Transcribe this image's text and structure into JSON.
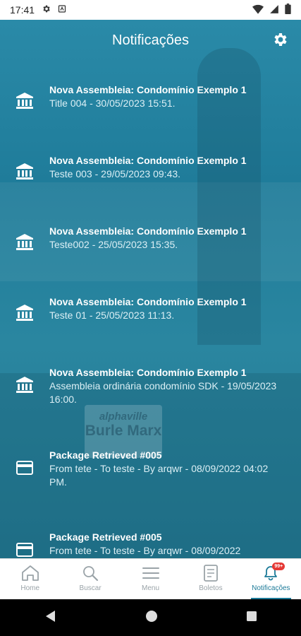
{
  "status_bar": {
    "time": "17:41"
  },
  "header": {
    "title": "Notificações"
  },
  "notifications": [
    {
      "title": "Nova Assembleia: Condomínio Exemplo 1",
      "subtitle": "Title 004 - 30/05/2023 15:51.",
      "icon": "bank-icon"
    },
    {
      "title": "Nova Assembleia: Condomínio Exemplo 1",
      "subtitle": "Teste 003 - 29/05/2023 09:43.",
      "icon": "bank-icon"
    },
    {
      "title": "Nova Assembleia: Condomínio Exemplo 1",
      "subtitle": "Teste002 - 25/05/2023 15:35.",
      "icon": "bank-icon"
    },
    {
      "title": "Nova Assembleia: Condomínio Exemplo 1",
      "subtitle": "Teste 01 - 25/05/2023 11:13.",
      "icon": "bank-icon"
    },
    {
      "title": "Nova Assembleia: Condomínio Exemplo 1",
      "subtitle": "Assembleia ordinária condomínio SDK - 19/05/2023 16:00.",
      "icon": "bank-icon"
    },
    {
      "title": "Package Retrieved #005",
      "subtitle": "From tete - To teste - By arqwr - 08/09/2022 04:02 PM.",
      "icon": "card-icon"
    },
    {
      "title": "Package Retrieved #005",
      "subtitle": "From tete - To teste - By arqwr - 08/09/2022",
      "icon": "card-icon"
    }
  ],
  "background_sign": {
    "line1": "alphaville",
    "line2": "Burle Marx"
  },
  "bottom_nav": {
    "items": [
      {
        "label": "Home",
        "icon": "home-icon"
      },
      {
        "label": "Buscar",
        "icon": "search-icon"
      },
      {
        "label": "Menu",
        "icon": "menu-icon"
      },
      {
        "label": "Boletos",
        "icon": "document-icon"
      },
      {
        "label": "Notificações",
        "icon": "bell-icon",
        "badge": "99+",
        "active": true
      }
    ]
  },
  "colors": {
    "accent": "#1c7a98",
    "badge": "#e53935"
  }
}
